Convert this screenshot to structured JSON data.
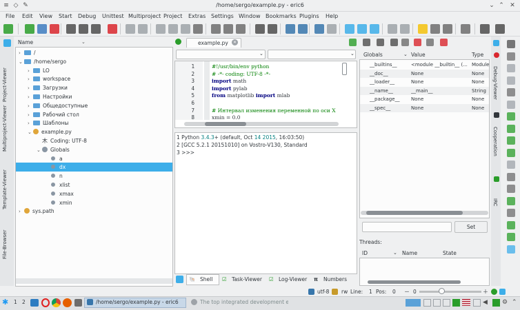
{
  "window": {
    "title": "/home/sergo/example.py - eric6"
  },
  "menu": [
    "File",
    "Edit",
    "View",
    "Start",
    "Debug",
    "Unittest",
    "Multiproject",
    "Project",
    "Extras",
    "Settings",
    "Window",
    "Bookmarks",
    "Plugins",
    "Help"
  ],
  "left_tabs": [
    "Project-Viewer",
    "Multiproject-Viewer",
    "Template-Viewer",
    "File-Browser"
  ],
  "tree": {
    "column": "Name",
    "rows": [
      {
        "label": "/",
        "indent": 0,
        "type": "folder",
        "arrow": "›"
      },
      {
        "label": "/home/sergo",
        "indent": 0,
        "type": "folder",
        "arrow": "⌄"
      },
      {
        "label": "LO",
        "indent": 1,
        "type": "folder",
        "arrow": "›"
      },
      {
        "label": "workspace",
        "indent": 1,
        "type": "folder",
        "arrow": "›"
      },
      {
        "label": "Загрузки",
        "indent": 1,
        "type": "folder",
        "arrow": "›"
      },
      {
        "label": "Настройки",
        "indent": 1,
        "type": "folder",
        "arrow": "›"
      },
      {
        "label": "Общедоступные",
        "indent": 1,
        "type": "folder",
        "arrow": "›"
      },
      {
        "label": "Рабочий стол",
        "indent": 1,
        "type": "folder",
        "arrow": "›"
      },
      {
        "label": "Шаблоны",
        "indent": 1,
        "type": "folder",
        "arrow": "›"
      },
      {
        "label": "example.py",
        "indent": 1,
        "type": "python",
        "arrow": "⌄"
      },
      {
        "label": "Coding: UTF-8",
        "indent": 2,
        "type": "coding",
        "arrow": ""
      },
      {
        "label": "Globals",
        "indent": 2,
        "type": "globals",
        "arrow": "⌄"
      },
      {
        "label": "a",
        "indent": 3,
        "type": "leaf",
        "arrow": ""
      },
      {
        "label": "dx",
        "indent": 3,
        "type": "leaf",
        "arrow": "",
        "selected": true
      },
      {
        "label": "n",
        "indent": 3,
        "type": "leaf",
        "arrow": ""
      },
      {
        "label": "xlist",
        "indent": 3,
        "type": "leaf",
        "arrow": ""
      },
      {
        "label": "xmax",
        "indent": 3,
        "type": "leaf",
        "arrow": ""
      },
      {
        "label": "xmin",
        "indent": 3,
        "type": "leaf",
        "arrow": ""
      },
      {
        "label": "sys.path",
        "indent": 0,
        "type": "python",
        "arrow": "›"
      }
    ]
  },
  "editor": {
    "tab": "example.py",
    "lines": [
      {
        "n": "1",
        "text": "#!/usr/bin/env python",
        "cls": "cm"
      },
      {
        "n": "2",
        "text": "# -*- coding: UTF-8 -*-",
        "cls": "cm"
      },
      {
        "n": "3",
        "kw": "import",
        "rest": " math"
      },
      {
        "n": "4",
        "kw": "import",
        "rest": " pylab"
      },
      {
        "n": "5",
        "kw": "from",
        "rest": " matplotlib ",
        "kw2": "import",
        "rest2": " mlab"
      },
      {
        "n": "6",
        "text": "",
        "cls": ""
      },
      {
        "n": "7",
        "text": "# Интервал изменения переменной по оси X",
        "cls": "cm"
      },
      {
        "n": "8",
        "text": "xmin = 0.0",
        "cls": ""
      }
    ]
  },
  "shell": {
    "l1_prefix": "1 Python ",
    "l1_ver": "3.4.3",
    "l1_rest_a": "+ (default, Oct ",
    "l1_day": "14",
    "l1_yr": " 2015",
    "l1_t": ", 16:03:50)",
    "l2": "2 [GCC 5.2.1 20151010] on Vostro-V130, Standard",
    "l3": "3 >>>"
  },
  "bottom_tabs": [
    "Shell",
    "Task-Viewer",
    "Log-Viewer",
    "Numbers"
  ],
  "variables": {
    "headers": [
      "Globals",
      "Value",
      "Type"
    ],
    "rows": [
      [
        "__builtins__",
        "<module __builtin__ (...",
        "Module"
      ],
      [
        "__doc__",
        "None",
        "None"
      ],
      [
        "__loader__",
        "None",
        "None"
      ],
      [
        "__name__",
        "__main__",
        "String"
      ],
      [
        "__package__",
        "None",
        "None"
      ],
      [
        "__spec__",
        "None",
        "None"
      ]
    ],
    "set_label": "Set",
    "threads_label": "Threads:",
    "thread_headers": [
      "ID",
      "Name",
      "State"
    ]
  },
  "right_tabs": [
    "Debug-Viewer",
    "Cooperation",
    "IRC"
  ],
  "status": {
    "encoding": "utf-8",
    "mode": "rw",
    "line_label": "Line:",
    "line": "1",
    "pos_label": "Pos:",
    "pos": "0",
    "zoom": "0"
  },
  "taskbar": {
    "desktops": [
      "1",
      "2"
    ],
    "task1": "/home/sergo/example.py - eric6",
    "task2": "The top integrated development env..."
  }
}
